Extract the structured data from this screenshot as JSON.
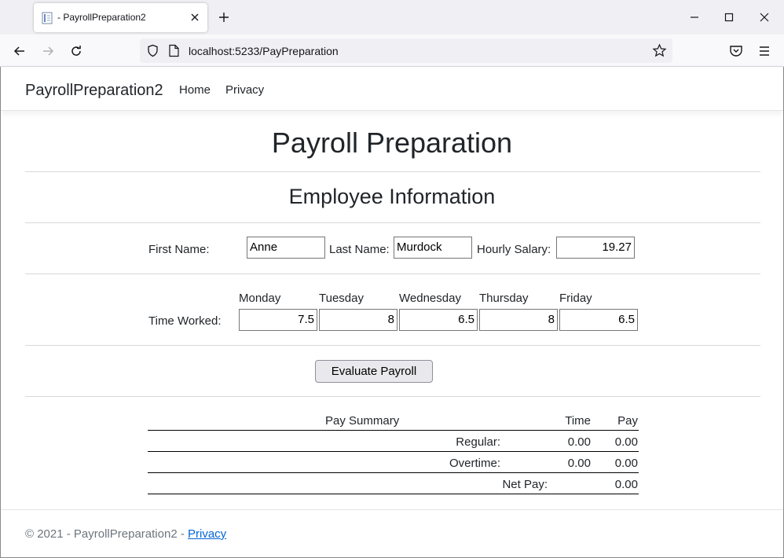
{
  "browser": {
    "tab_title": "- PayrollPreparation2",
    "url": "localhost:5233/PayPreparation"
  },
  "site": {
    "brand": "PayrollPreparation2",
    "nav": [
      "Home",
      "Privacy"
    ]
  },
  "page": {
    "title": "Payroll Preparation",
    "section_title": "Employee Information",
    "employee": {
      "first_name_label": "First Name:",
      "first_name": "Anne",
      "last_name_label": "Last Name:",
      "last_name": "Murdock",
      "salary_label": "Hourly Salary:",
      "salary": "19.27"
    },
    "time_worked": {
      "label": "Time Worked:",
      "days": [
        {
          "day": "Monday",
          "value": "7.5"
        },
        {
          "day": "Tuesday",
          "value": "8"
        },
        {
          "day": "Wednesday",
          "value": "6.5"
        },
        {
          "day": "Thursday",
          "value": "8"
        },
        {
          "day": "Friday",
          "value": "6.5"
        }
      ]
    },
    "evaluate_button": "Evaluate Payroll",
    "summary": {
      "header": {
        "title": "Pay Summary",
        "time": "Time",
        "pay": "Pay"
      },
      "regular": {
        "label": "Regular:",
        "time": "0.00",
        "pay": "0.00"
      },
      "overtime": {
        "label": "Overtime:",
        "time": "0.00",
        "pay": "0.00"
      },
      "net": {
        "label": "Net Pay:",
        "pay": "0.00"
      }
    }
  },
  "footer": {
    "text": "© 2021 - PayrollPreparation2 - ",
    "link": "Privacy"
  }
}
